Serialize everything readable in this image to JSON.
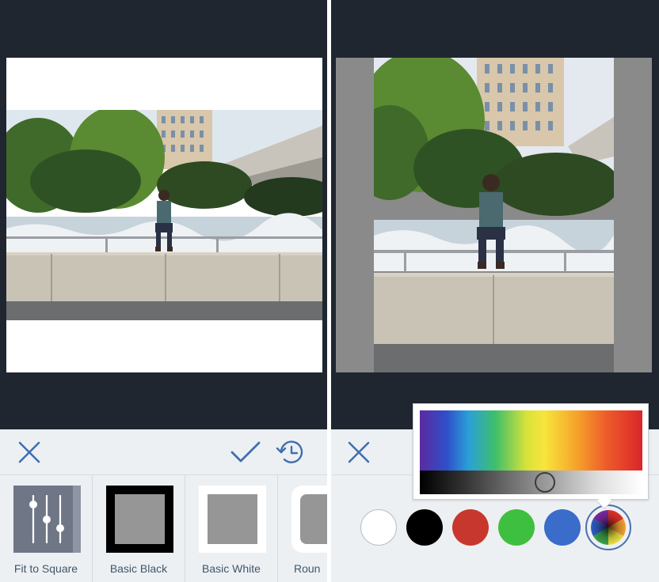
{
  "left_panel": {
    "toolbar": {
      "cancel_icon": "close-icon",
      "confirm_icon": "checkmark-icon",
      "history_icon": "history-clock-icon"
    },
    "frames": [
      {
        "label": "Fit to Square",
        "style": "fit",
        "icon": "sliders-icon"
      },
      {
        "label": "Basic Black",
        "style": "black"
      },
      {
        "label": "Basic White",
        "style": "white"
      },
      {
        "label": "Roun",
        "style": "round"
      }
    ]
  },
  "right_panel": {
    "toolbar": {
      "cancel_icon": "close-icon"
    },
    "color_picker": {
      "shade_level": 0.57
    },
    "swatches": [
      {
        "name": "white",
        "color": "#ffffff"
      },
      {
        "name": "black",
        "color": "#000000"
      },
      {
        "name": "red",
        "color": "#c8372d"
      },
      {
        "name": "green",
        "color": "#3fbf3f"
      },
      {
        "name": "blue",
        "color": "#3a6cc9"
      },
      {
        "name": "custom-color-wheel",
        "color": "multicolor",
        "selected": true
      }
    ]
  },
  "colors": {
    "background": "#1f2630",
    "toolbar": "#edf0f3",
    "accent": "#3f6fb2",
    "canvas_gray": "#8a8a8a"
  }
}
